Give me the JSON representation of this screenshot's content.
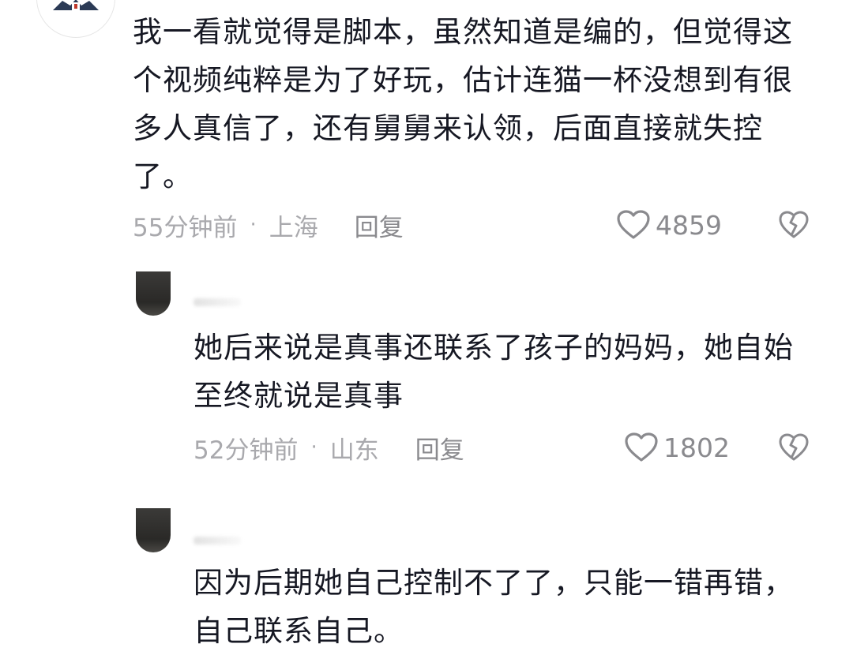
{
  "comments": [
    {
      "text": "我一看就觉得是脚本，虽然知道是编的，但觉得这个视频纯粹是为了好玩，估计连猫一杯没想到有很多人真信了，还有舅舅来认领，后面直接就失控了。",
      "time": "55分钟前",
      "location": "上海",
      "reply_label": "回复",
      "likes": "4859"
    },
    {
      "text": "她后来说是真事还联系了孩子的妈妈，她自始至终就说是真事",
      "time": "52分钟前",
      "location": "山东",
      "reply_label": "回复",
      "likes": "1802"
    },
    {
      "text": "因为后期她自己控制不了了，只能一错再错，自己联系自己。"
    }
  ],
  "meta_separator": "·",
  "icons": {
    "like": "heart-outline-icon",
    "dislike": "broken-heart-icon"
  },
  "colors": {
    "text": "#161823",
    "meta": "#a9a9ad",
    "icon": "#8a8a8e"
  }
}
